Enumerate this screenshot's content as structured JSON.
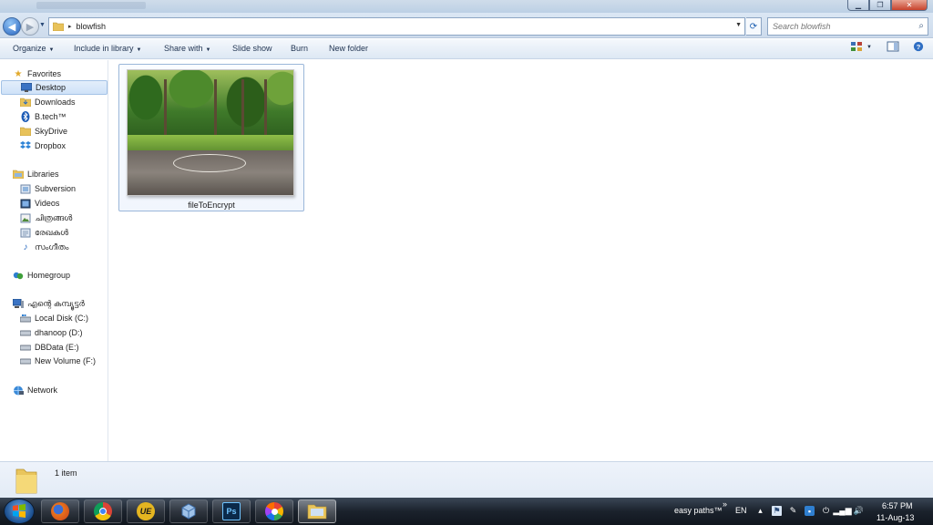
{
  "window": {
    "min_glyph": "▁",
    "max_glyph": "❐",
    "close_glyph": "✕"
  },
  "address": {
    "path": "blowfish",
    "separator": "▸",
    "dropdown_glyph": "▼",
    "refresh_glyph": "⟳"
  },
  "search": {
    "placeholder": "Search blowfish",
    "icon": "magnifier-icon"
  },
  "toolbar": {
    "organize": "Organize",
    "include_in_library": "Include in library",
    "share_with": "Share with",
    "slide_show": "Slide show",
    "burn": "Burn",
    "new_folder": "New folder",
    "dropdown_arrow": "▼"
  },
  "sidebar": {
    "favorites": {
      "label": "Favorites",
      "items": [
        {
          "label": "Desktop",
          "icon": "desktop-icon",
          "selected": true
        },
        {
          "label": "Downloads",
          "icon": "folder-icon"
        },
        {
          "label": "B.tech™",
          "icon": "bluetooth-icon"
        },
        {
          "label": "SkyDrive",
          "icon": "folder-icon"
        },
        {
          "label": "Dropbox",
          "icon": "dropbox-icon"
        }
      ]
    },
    "libraries": {
      "label": "Libraries",
      "items": [
        {
          "label": "Subversion",
          "icon": "library-icon"
        },
        {
          "label": "Videos",
          "icon": "videos-icon"
        },
        {
          "label": "ചിത്രങ്ങൾ",
          "icon": "pictures-icon"
        },
        {
          "label": "രേഖകൾ",
          "icon": "documents-icon"
        },
        {
          "label": "സംഗീതം",
          "icon": "music-icon"
        }
      ]
    },
    "homegroup": {
      "label": "Homegroup"
    },
    "computer": {
      "label": "എന്റെ കമ്പ്യൂട്ടർ",
      "items": [
        {
          "label": "Local Disk (C:)",
          "icon": "system-drive-icon"
        },
        {
          "label": "dhanoop (D:)",
          "icon": "drive-icon"
        },
        {
          "label": "DBData (E:)",
          "icon": "drive-icon"
        },
        {
          "label": "New Volume (F:)",
          "icon": "drive-icon"
        }
      ]
    },
    "network": {
      "label": "Network"
    }
  },
  "content": {
    "files": [
      {
        "name": "fileToEncrypt",
        "type": "image"
      }
    ]
  },
  "details": {
    "item_count": "1 item"
  },
  "taskbar": {
    "apps": [
      {
        "name": "firefox"
      },
      {
        "name": "chrome"
      },
      {
        "name": "ultraedit",
        "text": "UE"
      },
      {
        "name": "virtualbox"
      },
      {
        "name": "photoshop",
        "text": "Ps"
      },
      {
        "name": "picasa"
      },
      {
        "name": "windows-explorer",
        "active": true
      }
    ],
    "tray": {
      "easy_paths": "easy paths™",
      "chevron": "»",
      "language": "EN",
      "time": "6:57 PM",
      "date": "11-Aug-13"
    }
  },
  "colors": {
    "titlebar": "#c6d6e8",
    "selection": "#cfe2f8",
    "taskbar": "#1b222c",
    "close_button": "#c8432c"
  }
}
